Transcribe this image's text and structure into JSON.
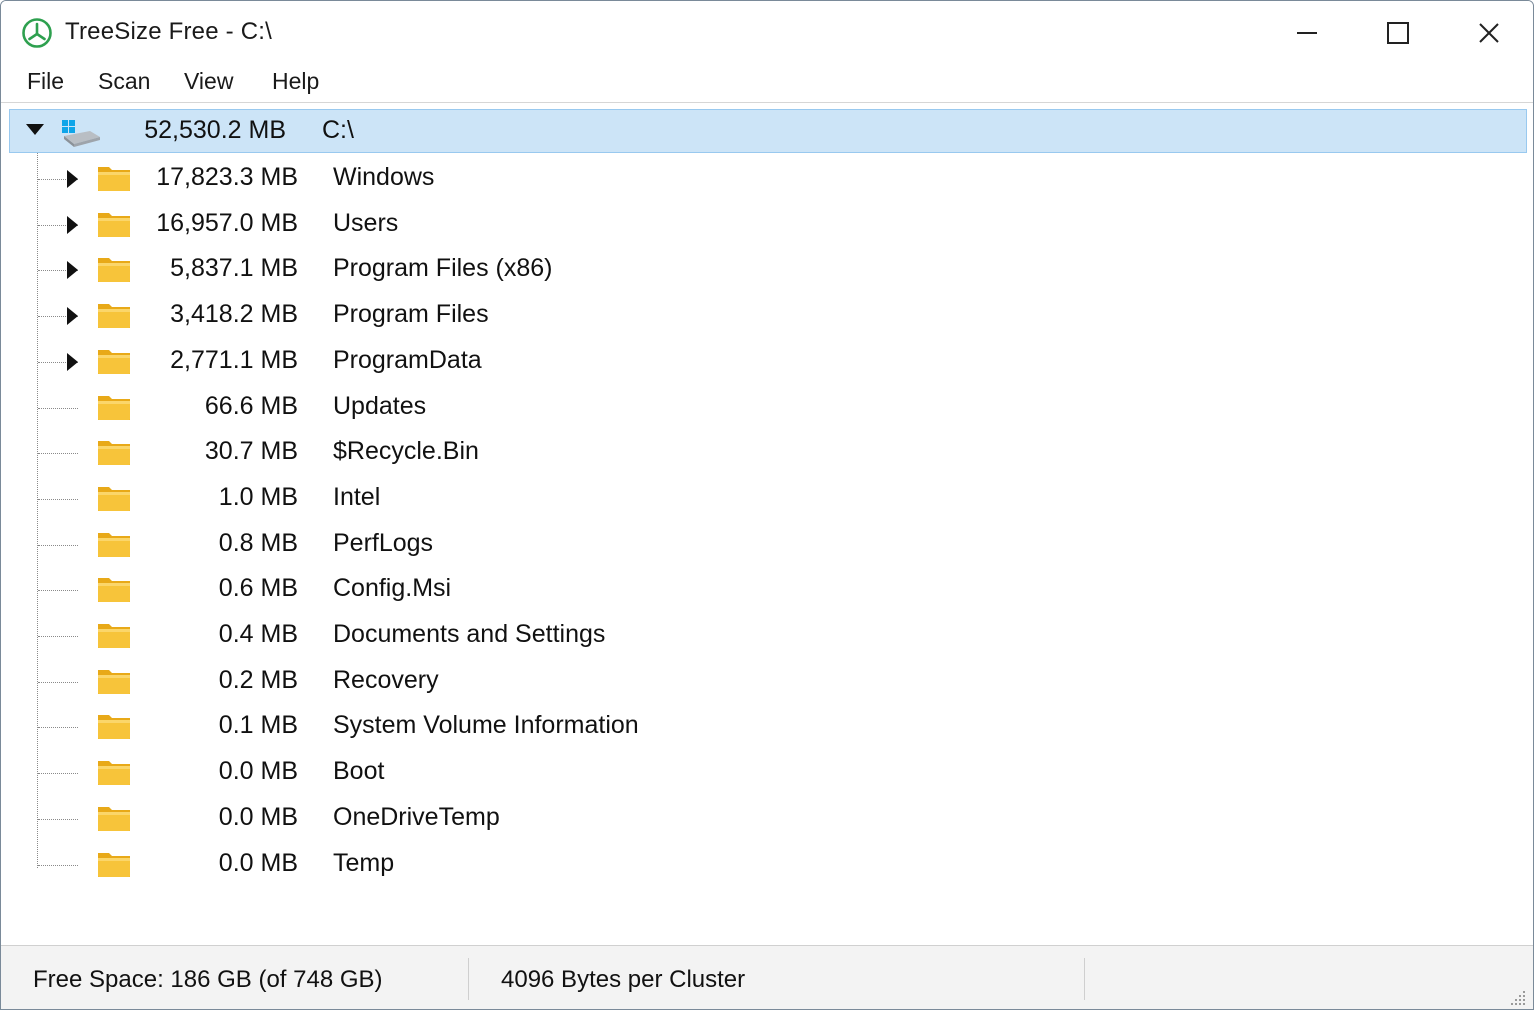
{
  "window": {
    "title": "TreeSize Free - C:\\"
  },
  "menu": {
    "items": [
      "File",
      "Scan",
      "View",
      "Help"
    ]
  },
  "root": {
    "size": "52,530.2 MB",
    "name": "C:\\",
    "expanded": true,
    "icon": "drive-icon"
  },
  "items": [
    {
      "size": "17,823.3 MB",
      "name": "Windows",
      "expandable": true
    },
    {
      "size": "16,957.0 MB",
      "name": "Users",
      "expandable": true
    },
    {
      "size": "5,837.1 MB",
      "name": "Program Files (x86)",
      "expandable": true
    },
    {
      "size": "3,418.2 MB",
      "name": "Program Files",
      "expandable": true
    },
    {
      "size": "2,771.1 MB",
      "name": "ProgramData",
      "expandable": true
    },
    {
      "size": "66.6 MB",
      "name": "Updates",
      "expandable": false
    },
    {
      "size": "30.7 MB",
      "name": "$Recycle.Bin",
      "expandable": false
    },
    {
      "size": "1.0 MB",
      "name": "Intel",
      "expandable": false
    },
    {
      "size": "0.8 MB",
      "name": "PerfLogs",
      "expandable": false
    },
    {
      "size": "0.6 MB",
      "name": "Config.Msi",
      "expandable": false
    },
    {
      "size": "0.4 MB",
      "name": "Documents and Settings",
      "expandable": false
    },
    {
      "size": "0.2 MB",
      "name": "Recovery",
      "expandable": false
    },
    {
      "size": "0.1 MB",
      "name": "System Volume Information",
      "expandable": false
    },
    {
      "size": "0.0 MB",
      "name": "Boot",
      "expandable": false
    },
    {
      "size": "0.0 MB",
      "name": "OneDriveTemp",
      "expandable": false
    },
    {
      "size": "0.0 MB",
      "name": "Temp",
      "expandable": false
    }
  ],
  "status": {
    "free_space": "Free Space: 186 GB  (of 748 GB)",
    "cluster": "4096 Bytes per Cluster"
  },
  "colors": {
    "selection": "#cce4f7",
    "selection_border": "#99c9ef",
    "folder": "#f7c43a",
    "app_icon": "#2ea04f"
  }
}
